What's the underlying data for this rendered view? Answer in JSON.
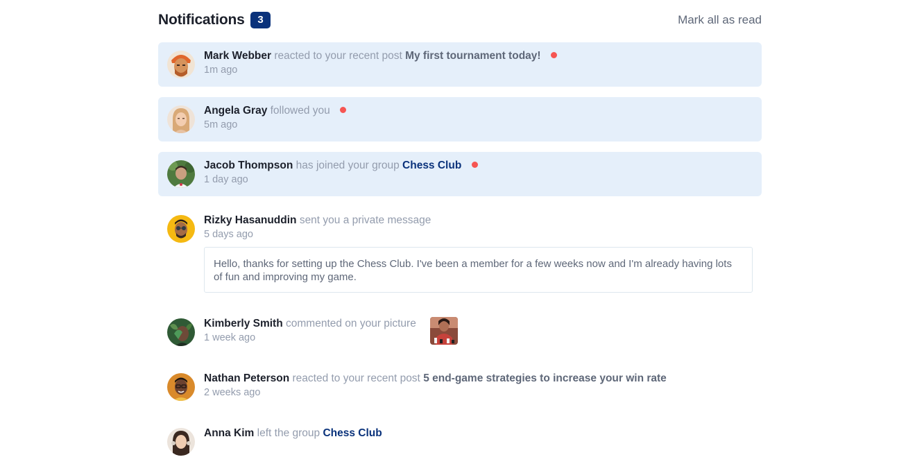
{
  "header": {
    "title": "Notifications",
    "count": "3",
    "mark_all_label": "Mark all as read"
  },
  "notifications": [
    {
      "name": "Mark Webber",
      "action": "reacted to your recent post",
      "target": "My first tournament today!",
      "time": "1m ago",
      "unread": true
    },
    {
      "name": "Angela Gray",
      "action": "followed you",
      "time": "5m ago",
      "unread": true
    },
    {
      "name": "Jacob Thompson",
      "action": "has joined your group",
      "target": "Chess Club",
      "time": "1 day ago",
      "unread": true
    },
    {
      "name": "Rizky Hasanuddin",
      "action": "sent you a private message",
      "time": "5 days ago",
      "unread": false,
      "message": "Hello, thanks for setting up the Chess Club. I've been a member for a few weeks now and I'm already having lots of fun and improving my game."
    },
    {
      "name": "Kimberly Smith",
      "action": "commented on your picture",
      "time": "1 week ago",
      "unread": false
    },
    {
      "name": "Nathan Peterson",
      "action": "reacted to your recent post",
      "target": "5 end-game strategies to increase your win rate",
      "time": "2 weeks ago",
      "unread": false
    },
    {
      "name": "Anna Kim",
      "action": "left the group",
      "target": "Chess Club",
      "unread": false
    }
  ],
  "colors": {
    "unread_bg": "#e5effa",
    "badge": "#0a327b",
    "dot": "#f65552",
    "text_dark": "#1c202b",
    "text_muted": "#939cad",
    "text_mid": "#5e6778"
  }
}
